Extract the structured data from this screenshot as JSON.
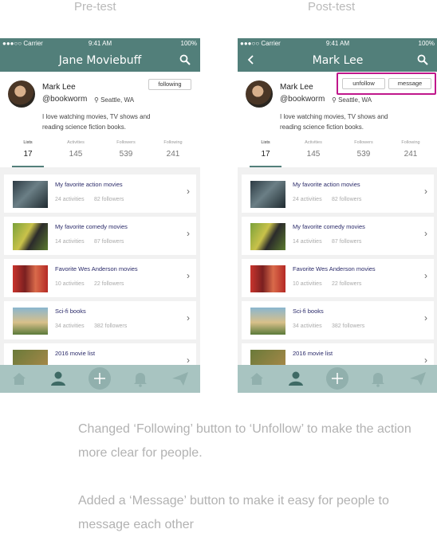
{
  "captions": {
    "pre": "Pre-test",
    "post": "Post-test",
    "note1": "Changed ‘Following’ button to ‘Unfollow’ to make the action more clear for people.",
    "note2": "Added a ‘Message’ button to make it easy for people to message each other"
  },
  "status": {
    "carrier": "●●●○○ Carrier ",
    "time": "9:41 AM",
    "battery": "100%"
  },
  "pre": {
    "title": "Jane Moviebuff",
    "follow_button": "following"
  },
  "post": {
    "title": "Mark Lee",
    "unfollow_button": "unfollow",
    "message_button": "message"
  },
  "profile": {
    "name": "Mark Lee",
    "handle": "@bookworm",
    "location": "Seattle, WA",
    "bio": "I love watching movies, TV shows and reading science fiction books."
  },
  "stats": [
    {
      "label": "Lists",
      "value": "17"
    },
    {
      "label": "Activities",
      "value": "145"
    },
    {
      "label": "Followers",
      "value": "539"
    },
    {
      "label": "Following",
      "value": "241"
    }
  ],
  "lists": [
    {
      "title": "My favorite action movies",
      "activities": "24 activities",
      "followers": "82 followers"
    },
    {
      "title": "My favorite comedy movies",
      "activities": "14 activities",
      "followers": "87 followers"
    },
    {
      "title": "Favorite Wes Anderson movies",
      "activities": "10 activities",
      "followers": "22 followers"
    },
    {
      "title": "Sci-fi books",
      "activities": "34 activities",
      "followers": "382 followers"
    },
    {
      "title": "2016 movie list",
      "activities": "",
      "followers": ""
    }
  ],
  "icons": [
    "home-icon",
    "profile-icon",
    "add-icon",
    "bell-icon",
    "send-icon"
  ],
  "colors": {
    "accent": "#527f7a",
    "tabbar": "#a8c4c1",
    "highlight": "#c0178b"
  }
}
